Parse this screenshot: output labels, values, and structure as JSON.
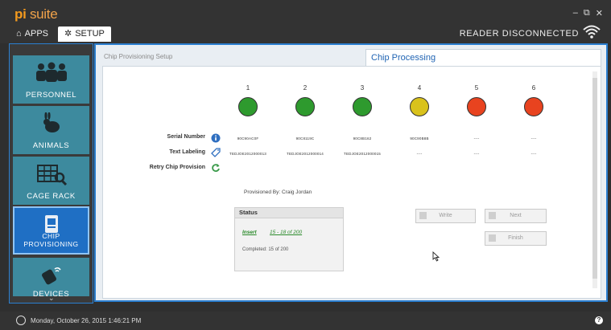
{
  "app": {
    "logo_pi": "pi",
    "logo_suite": "suite",
    "reader_status": "READER DISCONNECTED"
  },
  "window_controls": {
    "minimize": "–",
    "restore": "⧉",
    "close": "✕"
  },
  "tabs": [
    {
      "label": "APPS",
      "icon": "⌂"
    },
    {
      "label": "SETUP",
      "icon": "✲"
    }
  ],
  "sidebar": {
    "items": [
      {
        "label": "PERSONNEL",
        "icon": "personnel-icon"
      },
      {
        "label": "ANIMALS",
        "icon": "rabbit-icon"
      },
      {
        "label": "CAGE RACK",
        "icon": "cage-rack-icon"
      },
      {
        "label": "CHIP PROVISIONING",
        "icon": "chip-icon",
        "line1": "CHIP",
        "line2": "PROVISIONING"
      },
      {
        "label": "DEVICES",
        "icon": "device-icon"
      }
    ],
    "scroll_icon": "⌄"
  },
  "breadcrumb": "Chip Provisioning Setup",
  "page_title": "Chip Processing",
  "slots": [
    {
      "number": "1",
      "status_color": "#2e9a2e",
      "serial": "90C90AC0F",
      "text_label": "TEDJOE2012000013"
    },
    {
      "number": "2",
      "status_color": "#2e9a2e",
      "serial": "90C8119C",
      "text_label": "TEDJOE2012000014"
    },
    {
      "number": "3",
      "status_color": "#2e9a2e",
      "serial": "90C8B162",
      "text_label": "TEDJOE2012000015"
    },
    {
      "number": "4",
      "status_color": "#d9c21c",
      "serial": "90C90B8B",
      "text_label": "----"
    },
    {
      "number": "5",
      "status_color": "#e8431f",
      "serial": "----",
      "text_label": "----"
    },
    {
      "number": "6",
      "status_color": "#e8431f",
      "serial": "----",
      "text_label": "----"
    }
  ],
  "row_labels": {
    "serial": "Serial Number",
    "text_labeling": "Text Labeling",
    "retry": "Retry Chip Provision"
  },
  "provisioned_by": "Provisioned By:  Craig Jordan",
  "status": {
    "heading": "Status",
    "action": "Insert",
    "range": "15 - 18 of 200",
    "completed": "Completed:   15 of 200"
  },
  "buttons": {
    "write": "Write",
    "next": "Next",
    "finish": "Finish"
  },
  "footer": {
    "datetime": "Monday, October 26, 2015  1:46:21 PM",
    "help": "?"
  },
  "colors": {
    "accent": "#2b7fd0",
    "logo": "#f39a1e",
    "nav_tile": "#3d8a9e",
    "nav_active": "#1f6fc4"
  }
}
